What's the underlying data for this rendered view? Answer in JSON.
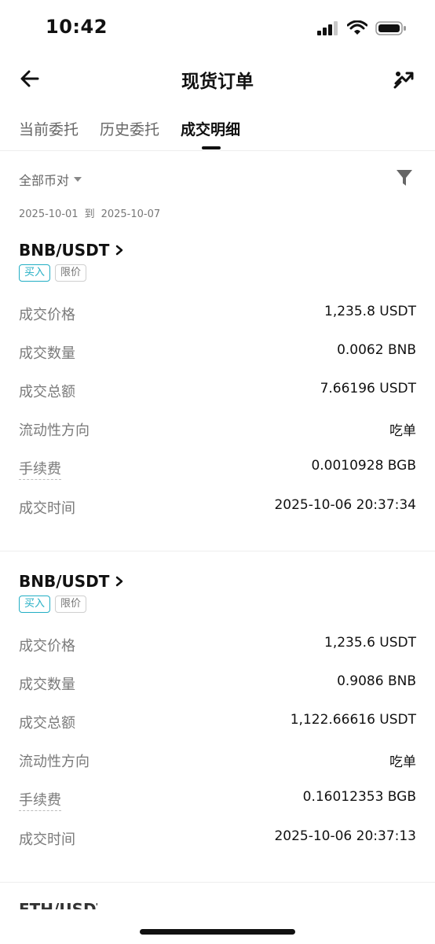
{
  "status_bar": {
    "time": "10:42"
  },
  "header": {
    "title": "现货订单",
    "back_icon": "arrow-left-icon",
    "share_icon": "share-icon"
  },
  "tabs": [
    {
      "label": "当前委托",
      "active": false
    },
    {
      "label": "历史委托",
      "active": false
    },
    {
      "label": "成交明细",
      "active": true
    }
  ],
  "filter": {
    "pair_select": "全部币对",
    "date_from": "2025-10-01",
    "date_sep": "到",
    "date_to": "2025-10-07",
    "filter_icon": "funnel-icon"
  },
  "orders": [
    {
      "pair": "BNB/USDT",
      "side_tag": "买入",
      "type_tag": "限价",
      "rows": [
        {
          "label": "成交价格",
          "value": "1,235.8 USDT"
        },
        {
          "label": "成交数量",
          "value": "0.0062 BNB"
        },
        {
          "label": "成交总额",
          "value": "7.66196 USDT"
        },
        {
          "label": "流动性方向",
          "value": "吃单"
        },
        {
          "label": "手续费",
          "value": "0.0010928 BGB"
        },
        {
          "label": "成交时间",
          "value": "2025-10-06 20:37:34"
        }
      ]
    },
    {
      "pair": "BNB/USDT",
      "side_tag": "买入",
      "type_tag": "限价",
      "rows": [
        {
          "label": "成交价格",
          "value": "1,235.6 USDT"
        },
        {
          "label": "成交数量",
          "value": "0.9086 BNB"
        },
        {
          "label": "成交总额",
          "value": "1,122.66616 USDT"
        },
        {
          "label": "流动性方向",
          "value": "吃单"
        },
        {
          "label": "手续费",
          "value": "0.16012353 BGB"
        },
        {
          "label": "成交时间",
          "value": "2025-10-06 20:37:13"
        }
      ]
    },
    {
      "pair": "ETH/USDT"
    }
  ],
  "colors": {
    "buy_tag": "#22aec4",
    "text_primary": "#111111",
    "text_secondary": "#7a7a7a"
  }
}
